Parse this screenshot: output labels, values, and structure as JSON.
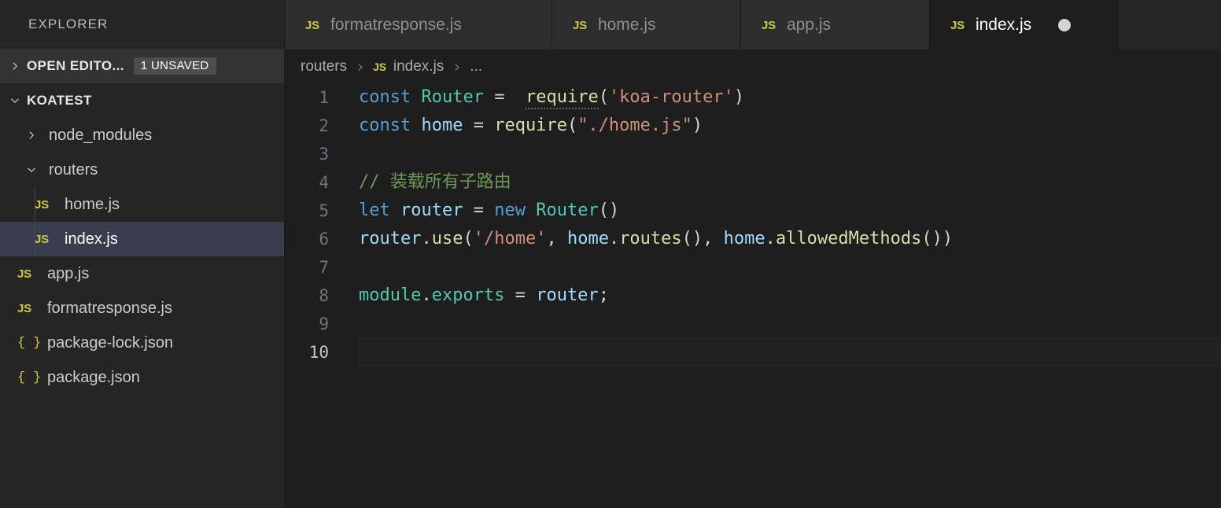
{
  "sidebar": {
    "title": "EXPLORER",
    "open_editors": {
      "label": "OPEN EDITO...",
      "badge": "1 UNSAVED",
      "twisty": "chevron-right-icon"
    },
    "workspace": {
      "label": "KOATEST",
      "twisty": "chevron-down-icon"
    },
    "tree": [
      {
        "label": "node_modules",
        "kind": "folder",
        "twisty": "chevron-right-icon",
        "depth": 0,
        "icon": "",
        "selected": false
      },
      {
        "label": "routers",
        "kind": "folder",
        "twisty": "chevron-down-icon",
        "depth": 0,
        "icon": "",
        "selected": false
      },
      {
        "label": "home.js",
        "kind": "file",
        "twisty": "",
        "depth": 1,
        "icon": "JS",
        "selected": false
      },
      {
        "label": "index.js",
        "kind": "file",
        "twisty": "",
        "depth": 1,
        "icon": "JS",
        "selected": true
      },
      {
        "label": "app.js",
        "kind": "file",
        "twisty": "",
        "depth": 0,
        "icon": "JS",
        "selected": false
      },
      {
        "label": "formatresponse.js",
        "kind": "file",
        "twisty": "",
        "depth": 0,
        "icon": "JS",
        "selected": false
      },
      {
        "label": "package-lock.json",
        "kind": "file",
        "twisty": "",
        "depth": 0,
        "icon": "{ }",
        "selected": false
      },
      {
        "label": "package.json",
        "kind": "file",
        "twisty": "",
        "depth": 0,
        "icon": "{ }",
        "selected": false
      }
    ]
  },
  "tabs": [
    {
      "label": "formatresponse.js",
      "icon": "JS",
      "active": false,
      "dirty": false
    },
    {
      "label": "home.js",
      "icon": "JS",
      "active": false,
      "dirty": false
    },
    {
      "label": "app.js",
      "icon": "JS",
      "active": false,
      "dirty": false
    },
    {
      "label": "index.js",
      "icon": "JS",
      "active": true,
      "dirty": true
    }
  ],
  "breadcrumbs": {
    "folder": "routers",
    "file": "index.js",
    "file_icon": "JS",
    "overflow": "...",
    "separator": "›"
  },
  "editor": {
    "active_line": 10,
    "lines": [
      {
        "n": "1",
        "text": "const Router =  require('koa-router')"
      },
      {
        "n": "2",
        "text": "const home = require(\"./home.js\")"
      },
      {
        "n": "3",
        "text": ""
      },
      {
        "n": "4",
        "text": "// 装载所有子路由"
      },
      {
        "n": "5",
        "text": "let router = new Router()"
      },
      {
        "n": "6",
        "text": "router.use('/home', home.routes(), home.allowedMethods())"
      },
      {
        "n": "7",
        "text": ""
      },
      {
        "n": "8",
        "text": "module.exports = router;"
      },
      {
        "n": "9",
        "text": ""
      },
      {
        "n": "10",
        "text": ""
      }
    ]
  },
  "colors": {
    "sidebar_bg": "#252526",
    "editor_bg": "#1e1e1e",
    "tab_inactive_bg": "#2d2d2d",
    "selection_bg": "#3a3d4d",
    "badge_bg": "#4d4d4d",
    "js_icon": "#cbcb41",
    "keyword": "#569cd6",
    "string": "#ce9178",
    "comment": "#6a9955",
    "function": "#dcdcaa",
    "variable": "#9cdcfe",
    "class": "#4ec9b0"
  }
}
